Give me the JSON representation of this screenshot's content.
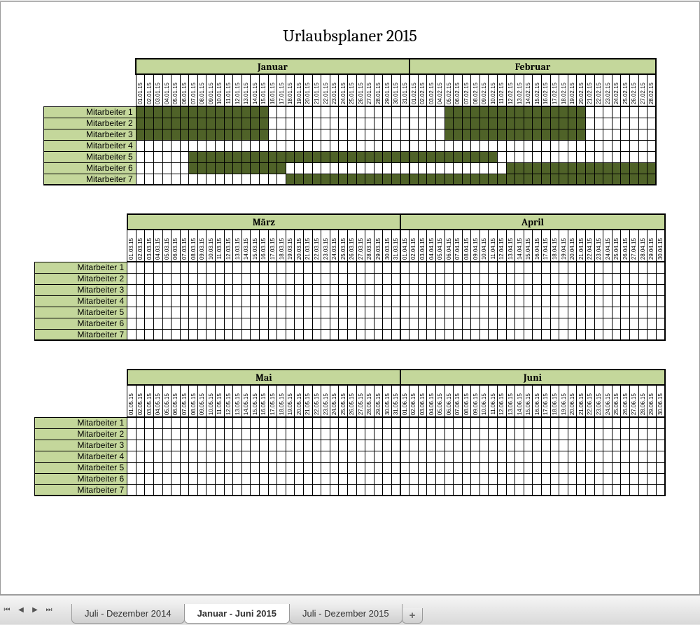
{
  "title": "Urlaubsplaner 2015",
  "employees": [
    "Mitarbeiter 1",
    "Mitarbeiter 2",
    "Mitarbeiter 3",
    "Mitarbeiter 4",
    "Mitarbeiter 5",
    "Mitarbeiter 6",
    "Mitarbeiter 7"
  ],
  "blocks": [
    {
      "months": [
        {
          "name": "Januar",
          "days": 31,
          "mm": "01",
          "yy": "15"
        },
        {
          "name": "Februar",
          "days": 28,
          "mm": "02",
          "yy": "15"
        }
      ],
      "vacations": {
        "Mitarbeiter 1": [
          [
            "01.01.15",
            "15.01.15"
          ],
          [
            "05.02.15",
            "20.02.15"
          ]
        ],
        "Mitarbeiter 2": [
          [
            "01.01.15",
            "15.01.15"
          ],
          [
            "05.02.15",
            "20.02.15"
          ]
        ],
        "Mitarbeiter 3": [
          [
            "01.01.15",
            "15.01.15"
          ],
          [
            "05.02.15",
            "20.02.15"
          ]
        ],
        "Mitarbeiter 4": [],
        "Mitarbeiter 5": [
          [
            "07.01.15",
            "10.02.15"
          ]
        ],
        "Mitarbeiter 6": [
          [
            "07.01.15",
            "17.01.15"
          ],
          [
            "12.02.15",
            "28.02.15"
          ]
        ],
        "Mitarbeiter 7": [
          [
            "18.01.15",
            "28.02.15"
          ]
        ]
      }
    },
    {
      "months": [
        {
          "name": "März",
          "days": 31,
          "mm": "03",
          "yy": "15"
        },
        {
          "name": "April",
          "days": 30,
          "mm": "04",
          "yy": "15"
        }
      ],
      "vacations": {}
    },
    {
      "months": [
        {
          "name": "Mai",
          "days": 31,
          "mm": "05",
          "yy": "15"
        },
        {
          "name": "Juni",
          "days": 30,
          "mm": "06",
          "yy": "15"
        }
      ],
      "vacations": {}
    }
  ],
  "tabs": {
    "items": [
      {
        "label": "Juli - Dezember 2014",
        "active": false
      },
      {
        "label": "Januar - Juni 2015",
        "active": true
      },
      {
        "label": "Juli - Dezember 2015",
        "active": false
      }
    ],
    "add": "+"
  }
}
